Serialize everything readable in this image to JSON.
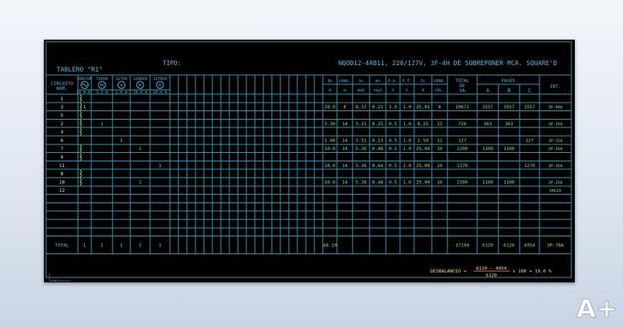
{
  "title": {
    "board": "TABLERO \"R1\"",
    "tipo_label": "TIPO:",
    "tipo_value": "NQOD12-4AB11, 220/127V, 3F-4H DE SOBREPONER MCA. SQUARE'D"
  },
  "headers": {
    "circuito": [
      "CIRCUITO",
      "NOM."
    ],
    "loads": [
      {
        "top": "1067VA",
        "icon": "fluorescent-lamp-icon",
        "symbol": "",
        "bottom": "10 H.P."
      },
      {
        "top": "728VA",
        "icon": "motor-icon",
        "symbol": "M",
        "bottom": "3.2 A"
      },
      {
        "top": "127VA",
        "icon": "outlet-v-icon",
        "symbol": "V",
        "bottom": "1.6 A"
      },
      {
        "top": "2200VA",
        "icon": "outlet-r-icon",
        "symbol": "R",
        "bottom": "10.0 A"
      },
      {
        "top": "1270VA",
        "icon": "outlet-r-icon",
        "symbol": "R",
        "bottom": "10.0 A"
      }
    ],
    "elec": [
      {
        "top": "In",
        "bottom": "A"
      },
      {
        "top": "LONG.",
        "bottom": "m"
      },
      {
        "top": "Sc",
        "bottom": "mm2"
      },
      {
        "top": "e%",
        "bottom": "regl"
      },
      {
        "top": "F.A.",
        "bottom": "%"
      },
      {
        "top": "F.T.",
        "bottom": "%"
      },
      {
        "top": "Ic",
        "bottom": "A"
      },
      {
        "top": "COND.",
        "bottom": "CAL."
      }
    ],
    "total_va": [
      "TOTAL",
      "DE",
      "VA"
    ],
    "fases": "FASES",
    "fase_cols": [
      "A",
      "B",
      "C"
    ],
    "int": "INT."
  },
  "rows": [
    {
      "circ": "1",
      "hook": true,
      "loads": [
        "",
        "",
        "",
        "",
        ""
      ],
      "elec": [
        "",
        "",
        "",
        "",
        "",
        "",
        "",
        ""
      ],
      "va": "",
      "a": "",
      "b": "",
      "c": "",
      "int": ""
    },
    {
      "circ": "3",
      "hook": true,
      "loads": [
        "1",
        "",
        "",
        "",
        ""
      ],
      "elec": [
        "28.0",
        "4",
        "8.37",
        "0.21",
        "1.0",
        "1.0",
        "35.01",
        "8"
      ],
      "va": "10671",
      "a": "3557",
      "b": "3557",
      "c": "3557",
      "int": "3P-40A"
    },
    {
      "circ": "5",
      "hook": true,
      "loads": [
        "",
        "",
        "",
        "",
        ""
      ],
      "elec": [
        "",
        "",
        "",
        "",
        "",
        "",
        "",
        ""
      ],
      "va": "",
      "a": "",
      "b": "",
      "c": "",
      "int": ""
    },
    {
      "circ": "2",
      "hook": true,
      "loads": [
        "",
        "1",
        "",
        "",
        ""
      ],
      "elec": [
        "3.30",
        "14",
        "3.31",
        "0.25",
        "0.5",
        "1.0",
        "8.25",
        "12"
      ],
      "va": "726",
      "a": "363",
      "b": "363",
      "c": "",
      "int": "2P-15A"
    },
    {
      "circ": "4",
      "hook": true,
      "loads": [
        "",
        "",
        "",
        "",
        ""
      ],
      "elec": [
        "",
        "",
        "",
        "",
        "",
        "",
        "",
        ""
      ],
      "va": "",
      "a": "",
      "b": "",
      "c": "",
      "int": ""
    },
    {
      "circ": "6",
      "hook": false,
      "loads": [
        "",
        "",
        "1",
        "",
        ""
      ],
      "elec": [
        "1.00",
        "14",
        "3.31",
        "0.13",
        "0.5",
        "1.0",
        "2.50",
        "12"
      ],
      "va": "127",
      "a": "",
      "b": "",
      "c": "127",
      "int": "1P-15A"
    },
    {
      "circ": "7",
      "hook": true,
      "loads": [
        "",
        "",
        "",
        "1",
        ""
      ],
      "elec": [
        "10.0",
        "14",
        "5.26",
        "0.48",
        "0.5",
        "1.0",
        "25.00",
        "10"
      ],
      "va": "2200",
      "a": "1100",
      "b": "1100",
      "c": "",
      "int": "2P-15A"
    },
    {
      "circ": "9",
      "hook": true,
      "loads": [
        "",
        "",
        "",
        "",
        ""
      ],
      "elec": [
        "",
        "",
        "",
        "",
        "",
        "",
        "",
        ""
      ],
      "va": "",
      "a": "",
      "b": "",
      "c": "",
      "int": ""
    },
    {
      "circ": "11",
      "hook": false,
      "loads": [
        "",
        "",
        "",
        "",
        "1"
      ],
      "elec": [
        "10.0",
        "14",
        "5.26",
        "0.64",
        "0.5",
        "1.0",
        "25.00",
        "10"
      ],
      "va": "1270",
      "a": "",
      "b": "",
      "c": "1270",
      "int": "1P-15A"
    },
    {
      "circ": "8",
      "hook": true,
      "loads": [
        "",
        "",
        "",
        "",
        ""
      ],
      "elec": [
        "",
        "",
        "",
        "",
        "",
        "",
        "",
        ""
      ],
      "va": "",
      "a": "",
      "b": "",
      "c": "",
      "int": ""
    },
    {
      "circ": "10",
      "hook": true,
      "loads": [
        "",
        "",
        "",
        "1",
        ""
      ],
      "elec": [
        "10.0",
        "14",
        "5.26",
        "0.48",
        "0.5",
        "1.0",
        "25.00",
        "10"
      ],
      "va": "2200",
      "a": "1100",
      "b": "1100",
      "c": "",
      "int": "2P-15A"
    },
    {
      "circ": "12",
      "hook": false,
      "loads": [
        "",
        "",
        "",
        "",
        ""
      ],
      "elec": [
        "",
        "",
        "",
        "",
        "",
        "",
        "",
        ""
      ],
      "va": "",
      "a": "",
      "b": "",
      "c": "",
      "int": "VACIO"
    }
  ],
  "totals": {
    "label": "TOTAL",
    "loads": [
      "1",
      "1",
      "1",
      "2",
      "1"
    ],
    "in": "48.19",
    "va": "17194",
    "a": "6120",
    "b": "6120",
    "c": "4954",
    "int": "3P-70A"
  },
  "desbalanceo": {
    "label": "DESBALANCEO =",
    "numerator": "6120 - 4954",
    "denominator": "6120",
    "tail": "x 100 = 19.0 %"
  },
  "axis_label": "Y",
  "logo_text": "A+",
  "colors": {
    "cyan": "#46c2ec",
    "green": "#7df07d",
    "white": "#eaeaea",
    "yellow": "#f3e84c",
    "line": "#2fa6c9",
    "sheet": "#000000"
  }
}
